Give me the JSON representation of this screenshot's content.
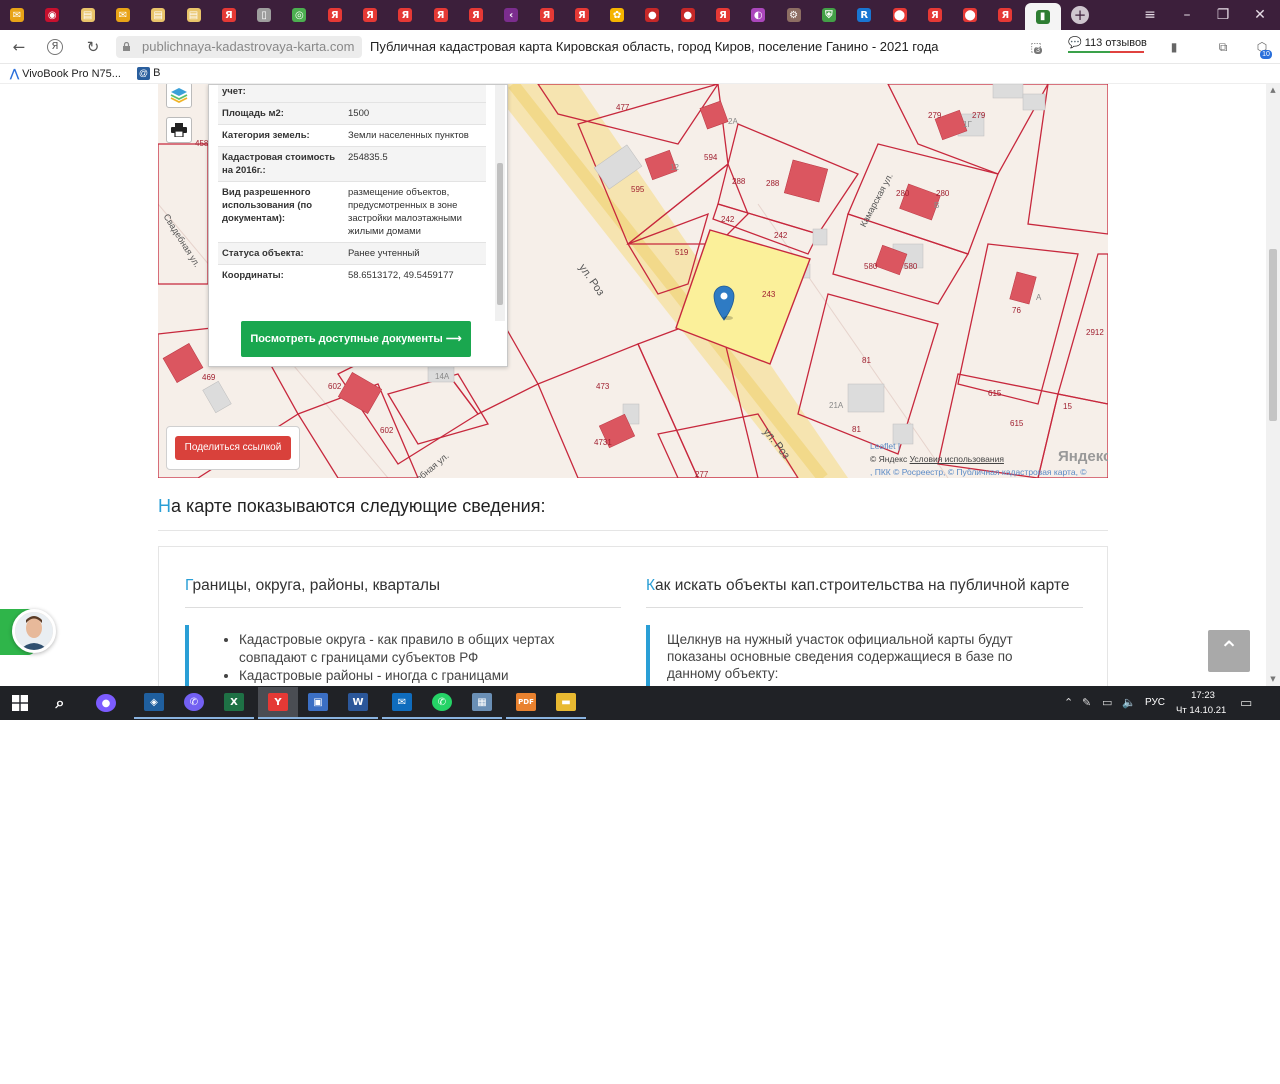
{
  "browser": {
    "url": "publichnaya-kadastrovaya-karta.com",
    "page_title": "Публичная кадастровая карта Кировская область, город Киров, поселение Ганино - 2021 года",
    "reviews": "113 отзывов",
    "extension_badge": "10",
    "download_badge": "3",
    "tab_icons": [
      {
        "name": "mail",
        "color": "#e8a317",
        "glyph": "✉"
      },
      {
        "name": "lips",
        "color": "#c8102e",
        "glyph": "◉"
      },
      {
        "name": "doc",
        "color": "#e9c46a",
        "glyph": "▤"
      },
      {
        "name": "mail",
        "color": "#e8a317",
        "glyph": "✉"
      },
      {
        "name": "doc",
        "color": "#e9c46a",
        "glyph": "▤"
      },
      {
        "name": "doc",
        "color": "#e9c46a",
        "glyph": "▤"
      },
      {
        "name": "yandex",
        "color": "#e53935",
        "glyph": "Я"
      },
      {
        "name": "page",
        "color": "#9e9e9e",
        "glyph": "▯"
      },
      {
        "name": "green",
        "color": "#4caf50",
        "glyph": "◎"
      },
      {
        "name": "yandex",
        "color": "#e53935",
        "glyph": "Я"
      },
      {
        "name": "yandex",
        "color": "#e53935",
        "glyph": "Я"
      },
      {
        "name": "yandex",
        "color": "#e53935",
        "glyph": "Я"
      },
      {
        "name": "yandex",
        "color": "#e53935",
        "glyph": "Я"
      },
      {
        "name": "yandex",
        "color": "#e53935",
        "glyph": "Я"
      },
      {
        "name": "back",
        "color": "#7b2d8e",
        "glyph": "‹"
      },
      {
        "name": "yandex",
        "color": "#e53935",
        "glyph": "Я"
      },
      {
        "name": "yandex",
        "color": "#e53935",
        "glyph": "Я"
      },
      {
        "name": "flower",
        "color": "#f5b400",
        "glyph": "✿"
      },
      {
        "name": "red",
        "color": "#c62828",
        "glyph": "●"
      },
      {
        "name": "red",
        "color": "#c62828",
        "glyph": "●"
      },
      {
        "name": "yandex",
        "color": "#e53935",
        "glyph": "Я"
      },
      {
        "name": "purple",
        "color": "#ab47bc",
        "glyph": "◐"
      },
      {
        "name": "gear",
        "color": "#8d6e63",
        "glyph": "⚙"
      },
      {
        "name": "shield",
        "color": "#43a047",
        "glyph": "⛨"
      },
      {
        "name": "r",
        "color": "#1976d2",
        "glyph": "R"
      },
      {
        "name": "pin",
        "color": "#e53935",
        "glyph": "⬤"
      },
      {
        "name": "yandex",
        "color": "#e53935",
        "glyph": "Я"
      },
      {
        "name": "pin",
        "color": "#e53935",
        "glyph": "⬤"
      },
      {
        "name": "yandex",
        "color": "#e53935",
        "glyph": "Я"
      },
      {
        "name": "map",
        "color": "#2e7d32",
        "glyph": "▮"
      }
    ],
    "bookmarks": [
      "VivoBook Pro N75...",
      "B"
    ]
  },
  "map": {
    "popup_rows": [
      {
        "key": "учет:",
        "value": ""
      },
      {
        "key": "Площадь м2:",
        "value": "1500"
      },
      {
        "key": "Категория земель:",
        "value": "Земли населенных пунктов"
      },
      {
        "key": "Кадастровая стоимость на 2016г.:",
        "value": "254835.5"
      },
      {
        "key": "Вид разрешенного использования (по документам):",
        "value": "размещение объектов, предусмотренных в зоне застройки малоэтажными жилыми домами"
      },
      {
        "key": "Статуса объекта:",
        "value": "Ранее учтенный"
      },
      {
        "key": "Координаты:",
        "value": "58.6513172, 49.5459177"
      }
    ],
    "docs_button": "Посмотреть доступные документы ⟶",
    "share_button": "Поделиться ссылкой",
    "streets": [
      "ул. Роз",
      "ул. Роз",
      "Свадебная ул.",
      "Камарская ул.",
      "ебная ул."
    ],
    "lot_numbers": [
      "477",
      "594",
      "595",
      "288",
      "288",
      "242",
      "242",
      "519",
      "243",
      "279",
      "279",
      "280",
      "280",
      "580",
      "580",
      "76",
      "2912",
      "81",
      "81",
      "615",
      "615",
      "15",
      "473",
      "4731",
      "602",
      "602",
      "469",
      "458",
      "14А",
      "21А",
      "277",
      "1Г",
      "2А",
      "12",
      "B",
      "А"
    ],
    "attribution": {
      "leaflet": "Leaflet |",
      "yandex": "© Яндекс",
      "terms": "Условия использования",
      "pkk": ", ПКК © Росреестр, © Публичная кадастровая карта, ©",
      "logo": "Яндекс"
    }
  },
  "content": {
    "section_heading_first": "Н",
    "section_heading_rest": "а карте показываются следующие сведения:",
    "card1": {
      "title_first": "Г",
      "title_rest": "раницы, округа, районы, кварталы",
      "items": [
        "Кадастровые округа - как правило в общих чертах совпадают с границами субъектов РФ",
        "Кадастровые районы - иногда с границами"
      ]
    },
    "card2": {
      "title_first": "К",
      "title_rest": "ак искать объекты кап.строительства на публичной карте",
      "text": "Щелкнув на нужный участок официальной карты будут показаны основные сведения содержащиеся в базе по данному объекту:"
    }
  },
  "taskbar": {
    "apps": [
      {
        "name": "search",
        "glyph": "⌕",
        "color": "#202226"
      },
      {
        "name": "alice",
        "glyph": "●",
        "color": "#7c5cff"
      },
      {
        "name": "app-blue",
        "glyph": "◈",
        "color": "#1f5f9e"
      },
      {
        "name": "viber",
        "glyph": "✆",
        "color": "#7360f2"
      },
      {
        "name": "excel",
        "glyph": "X",
        "color": "#1e7145"
      },
      {
        "name": "yandex-browser",
        "glyph": "Y",
        "color": "#e53935"
      },
      {
        "name": "floppy",
        "glyph": "▣",
        "color": "#3b6fc4"
      },
      {
        "name": "word",
        "glyph": "W",
        "color": "#2b579a"
      },
      {
        "name": "outlook",
        "glyph": "✉",
        "color": "#0f6cbd"
      },
      {
        "name": "whatsapp",
        "glyph": "✆",
        "color": "#25d366"
      },
      {
        "name": "calc",
        "glyph": "▦",
        "color": "#6a8fb5"
      },
      {
        "name": "pdf",
        "glyph": "PDF",
        "color": "#e9822f"
      },
      {
        "name": "explorer",
        "glyph": "▬",
        "color": "#e8b931"
      }
    ],
    "lang": "РУС",
    "time": "17:23",
    "date": "Чт 14.10.21"
  }
}
